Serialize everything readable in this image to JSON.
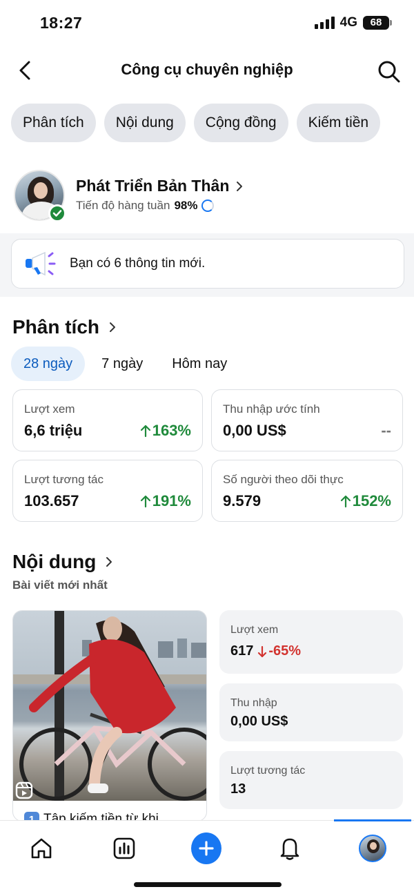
{
  "status_bar": {
    "time": "18:27",
    "network": "4G",
    "battery": "68"
  },
  "header": {
    "title": "Công cụ chuyên nghiệp"
  },
  "tabs": [
    {
      "label": "Phân tích"
    },
    {
      "label": "Nội dung"
    },
    {
      "label": "Cộng đồng"
    },
    {
      "label": "Kiếm tiền"
    }
  ],
  "profile": {
    "name": "Phát Triển Bản Thân",
    "progress_label": "Tiến độ hàng tuần",
    "progress_value": "98%"
  },
  "notice": {
    "text": "Bạn có 6 thông tin mới."
  },
  "analytics": {
    "title": "Phân tích",
    "ranges": [
      {
        "label": "28 ngày",
        "active": true
      },
      {
        "label": "7 ngày",
        "active": false
      },
      {
        "label": "Hôm nay",
        "active": false
      }
    ],
    "stats": [
      {
        "label": "Lượt xem",
        "value": "6,6 triệu",
        "change": "163%",
        "trend": "up"
      },
      {
        "label": "Thu nhập ước tính",
        "value": "0,00 US$",
        "change": "--",
        "trend": "none"
      },
      {
        "label": "Lượt tương tác",
        "value": "103.657",
        "change": "191%",
        "trend": "up"
      },
      {
        "label": "Số người theo dõi thực",
        "value": "9.579",
        "change": "152%",
        "trend": "up"
      }
    ]
  },
  "content": {
    "title": "Nội dung",
    "subtitle": "Bài viết mới nhất",
    "post": {
      "number_badge": "1",
      "caption": "Tập kiếm tiền từ khi"
    },
    "metrics": [
      {
        "label": "Lượt xem",
        "value": "617",
        "change": "-65%",
        "trend": "down"
      },
      {
        "label": "Thu nhập",
        "value": "0,00 US$"
      },
      {
        "label": "Lượt tương tác",
        "value": "13"
      }
    ]
  },
  "colors": {
    "accent": "#1877f2",
    "positive": "#1f8a3b",
    "negative": "#d2332f"
  }
}
